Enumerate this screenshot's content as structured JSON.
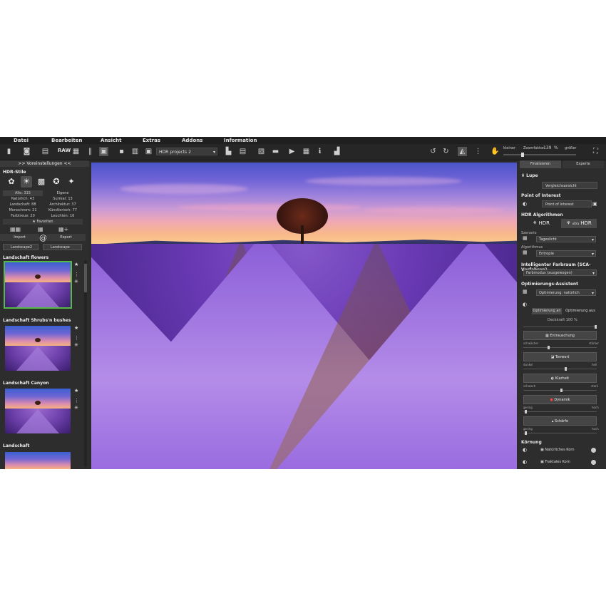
{
  "menu": [
    "Datei",
    "Bearbeiten",
    "Ansicht",
    "Extras",
    "Addons",
    "Information"
  ],
  "toolbar": {
    "raw_label": "RAW",
    "project": "HDR projects 2",
    "zoom_small": "kleiner",
    "zoom_factor_label": "Zoomfaktor",
    "zoom_value": "139",
    "zoom_unit": "%",
    "zoom_large": "größer",
    "zoom_fraction": 0.25
  },
  "left_panel": {
    "title": ">> Voreinstellungen <<",
    "styles_heading": "HDR-Stile",
    "counts": [
      [
        "Alle: 315",
        "Eigene"
      ],
      [
        "Natürlich: 43",
        "Surreal: 13"
      ],
      [
        "Landschaft: 88",
        "Architektur: 37"
      ],
      [
        "Monochrom: 21",
        "Künstlerisch: 77"
      ],
      [
        "Farbtreue: 20",
        "Leuchten: 16"
      ]
    ],
    "favorites": "Favoriten",
    "import": "Import",
    "export": "Export",
    "filter_left": "Landscape2",
    "filter_right": "Landscape",
    "presets": [
      {
        "name": "Landschaft flowers"
      },
      {
        "name": "Landschaft Shrubs'n bushes"
      },
      {
        "name": "Landschaft Canyon"
      },
      {
        "name": "Landschaft"
      }
    ]
  },
  "right_panel": {
    "tab_active": "Finalisieren",
    "tab_inactive": "Experte",
    "lupe": "Lupe",
    "vergleich": "Vergleichsansicht",
    "poi_heading": "Point of Interest",
    "poi_button": "Point of Interest",
    "algo_heading": "HDR Algorithmen",
    "hdr_label": "HDR",
    "hdr_ultra": "ultra",
    "hdr_ultra2": "HDR",
    "szenario_label": "Szenario",
    "szenario_value": "Tageslicht",
    "algorithmus_label": "Algorithmus",
    "algorithmus_value": "Entropie",
    "color_heading": "Intelligenter Farbraum (SCA-Verfahren)",
    "color_value": "Farbmodus (ausgewogen)",
    "opt_heading": "Optimierungs-Assistent",
    "opt_value": "Optimierung: natürlich",
    "opt_on": "Optimierung an",
    "opt_off": "Optimierung aus",
    "deckkraft_label": "Deckkraft",
    "deckkraft_value": "100",
    "deckkraft_unit": "%",
    "adjustments": [
      {
        "name": "Entrauschung",
        "left": "schwächer",
        "right": "stärker"
      },
      {
        "name": "Tonwert",
        "left": "dunkel",
        "right": "hell"
      },
      {
        "name": "Klarheit",
        "left": "schwach",
        "right": "stark"
      },
      {
        "name": "Dynamik",
        "left": "gering",
        "right": "hoch"
      },
      {
        "name": "Schärfe",
        "left": "gering",
        "right": "hoch"
      }
    ],
    "grain_heading": "Körnung",
    "grain1": "Natürliches Korn",
    "grain2": "Fraktales Korn"
  }
}
